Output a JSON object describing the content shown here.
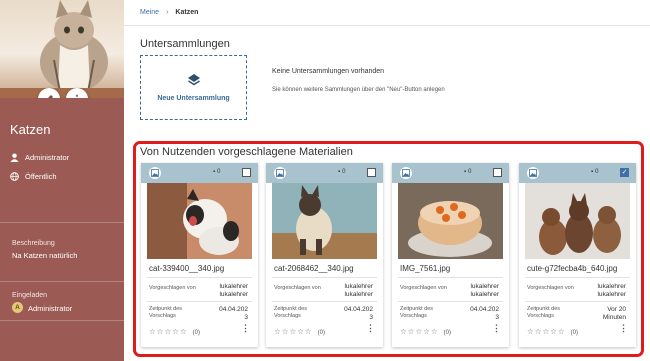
{
  "breadcrumb": {
    "home": "Meine",
    "current": "Katzen"
  },
  "sidebar": {
    "title": "Katzen",
    "owner": "Administrator",
    "visibility": "Öffentlich",
    "description_label": "Beschreibung",
    "description": "Na Katzen natürlich",
    "logged_in_label": "Eingeladen",
    "user_initial": "A",
    "user": "Administrator"
  },
  "subcollections": {
    "title": "Untersammlungen",
    "new_label": "Neue Untersammlung",
    "empty_text": "Keine Untersammlungen vorhanden",
    "hint": "Sie können weitere Sammlungen über den \"Neu\"-Button anlegen"
  },
  "suggested": {
    "title": "Von Nutzenden vorgeschlagene Materialien",
    "suggested_by_label": "Vorgeschlagen von",
    "date_label": "Zeitpunkt des Vorschlags",
    "cards": [
      {
        "file": "cat-339400__340.jpg",
        "comments": "0",
        "by": "lukalehrer lukalehrer",
        "date": "04.04.202 3",
        "rating": "(0)",
        "checked": false
      },
      {
        "file": "cat-2068462__340.jpg",
        "comments": "0",
        "by": "lukalehrer lukalehrer",
        "date": "04.04.202 3",
        "rating": "(0)",
        "checked": false
      },
      {
        "file": "IMG_7561.jpg",
        "comments": "0",
        "by": "lukalehrer lukalehrer",
        "date": "04.04.202 3",
        "rating": "(0)",
        "checked": false
      },
      {
        "file": "cute-g72fecba4b_640.jpg",
        "comments": "0",
        "by": "lukalehrer lukalehrer",
        "date": "Vor 20 Minuten",
        "rating": "(0)",
        "checked": true
      }
    ]
  },
  "colors": {
    "sidebar": "#9b5a53",
    "accent": "#3f6fa8",
    "card_header": "#a9c3ce",
    "highlight_frame": "#e01b1b"
  }
}
